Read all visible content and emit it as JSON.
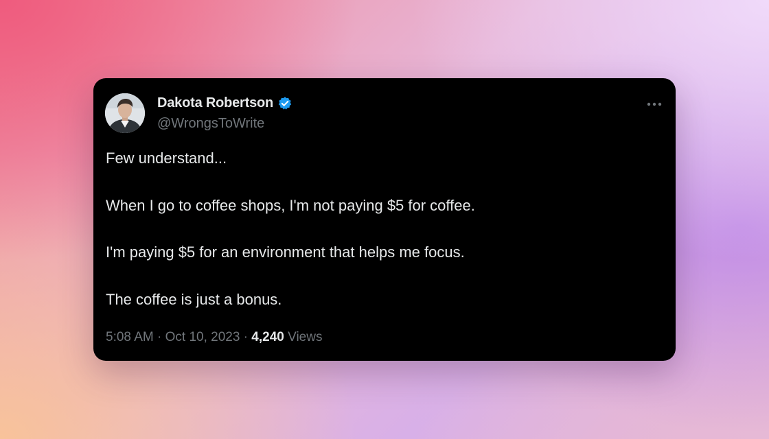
{
  "tweet": {
    "author_name": "Dakota Robertson",
    "handle": "@WrongsToWrite",
    "verified": true,
    "paragraphs": [
      "Few understand...",
      "When I go to coffee shops, I'm not paying $5 for coffee.",
      "I'm paying $5 for an environment that helps me focus.",
      "The coffee is just a bonus."
    ],
    "time": "5:08 AM",
    "separator": " · ",
    "date": "Oct 10, 2023",
    "views_count": "4,240",
    "views_label": "Views"
  },
  "icons": {
    "verified": "verified-badge-icon",
    "more": "more-options-icon"
  },
  "colors": {
    "card_background": "#000000",
    "primary_text": "#e7e9ea",
    "secondary_text": "#71767b",
    "verified_blue": "#1d9bf0"
  }
}
